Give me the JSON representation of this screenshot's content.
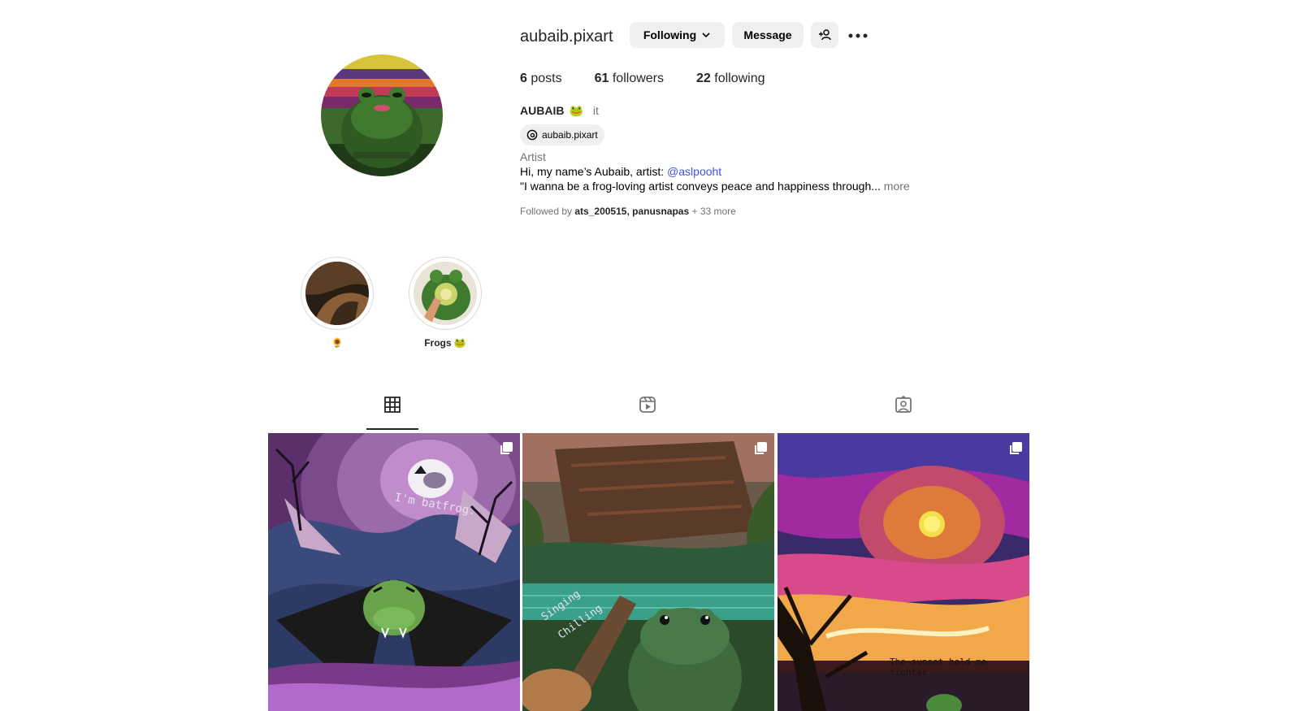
{
  "profile": {
    "username": "aubaib.pixart",
    "following_label": "Following",
    "message_label": "Message",
    "posts_count": "6",
    "posts_label": "posts",
    "followers_count": "61",
    "followers_label": "followers",
    "following_count": "22",
    "following_count_label": "following",
    "display_name": "AUBAIB",
    "display_name_emoji": "🐸",
    "pronouns": "it",
    "threads_handle": "aubaib.pixart",
    "category": "Artist",
    "bio_line1_prefix": "Hi, my name’s Aubaib, artist: ",
    "bio_line1_mention": "@aslpooht",
    "bio_line2": "\"I wanna be a frog-loving artist conveys peace and happiness through...",
    "bio_more": " more",
    "followed_by_prefix": "Followed by ",
    "followed_by_user1": "ats_200515",
    "followed_by_sep": ", ",
    "followed_by_user2": "panusnapas",
    "followed_by_suffix": " + 33 more"
  },
  "highlights": [
    {
      "label": "🌻"
    },
    {
      "label": "Frogs 🐸"
    }
  ],
  "tabs": [
    {
      "name": "posts",
      "icon": "grid-icon",
      "active": true
    },
    {
      "name": "reels",
      "icon": "reels-icon",
      "active": false
    },
    {
      "name": "tagged",
      "icon": "tagged-icon",
      "active": false
    }
  ],
  "posts": [
    {
      "caption": "I'm batfrog.",
      "multi": true
    },
    {
      "caption_a": "Singing",
      "caption_b": "Chilling",
      "multi": true
    },
    {
      "caption": "The sunset held me tighter.",
      "multi": true
    }
  ],
  "colors": {
    "link": "#4150f7",
    "button_bg": "#efefef",
    "muted_text": "#737373"
  }
}
